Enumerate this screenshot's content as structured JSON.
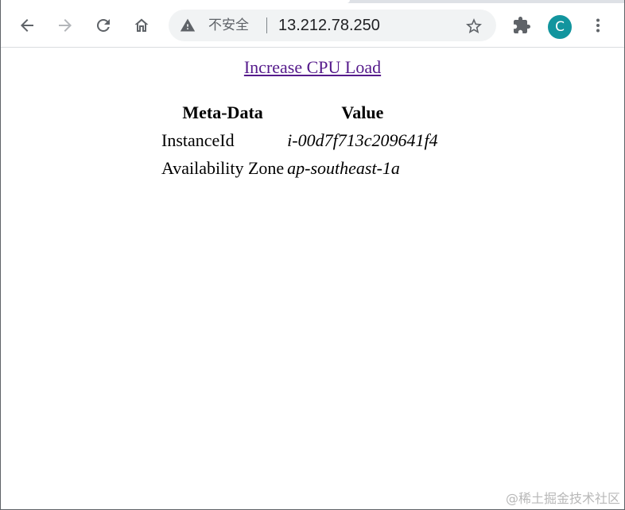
{
  "browser": {
    "toolbar": {
      "back_icon": "arrow-left-icon",
      "forward_icon": "arrow-right-icon",
      "reload_icon": "reload-icon",
      "home_icon": "home-icon"
    },
    "omnibox": {
      "security_icon": "warning-triangle-icon",
      "security_label": "不安全",
      "url": "13.212.78.250",
      "bookmark_icon": "star-icon"
    },
    "extensions_icon": "puzzle-piece-icon",
    "profile_initial": "C",
    "profile_color": "#12959e",
    "menu_icon": "kebab-menu-icon"
  },
  "page": {
    "link_text": "Increase CPU Load",
    "link_color": "#551a8b",
    "table": {
      "headers": [
        "Meta-Data",
        "Value"
      ],
      "rows": [
        [
          "InstanceId",
          "i-00d7f713c209641f4"
        ],
        [
          "Availability Zone",
          "ap-southeast-1a"
        ]
      ]
    }
  },
  "watermark": "@稀土掘金技术社区"
}
